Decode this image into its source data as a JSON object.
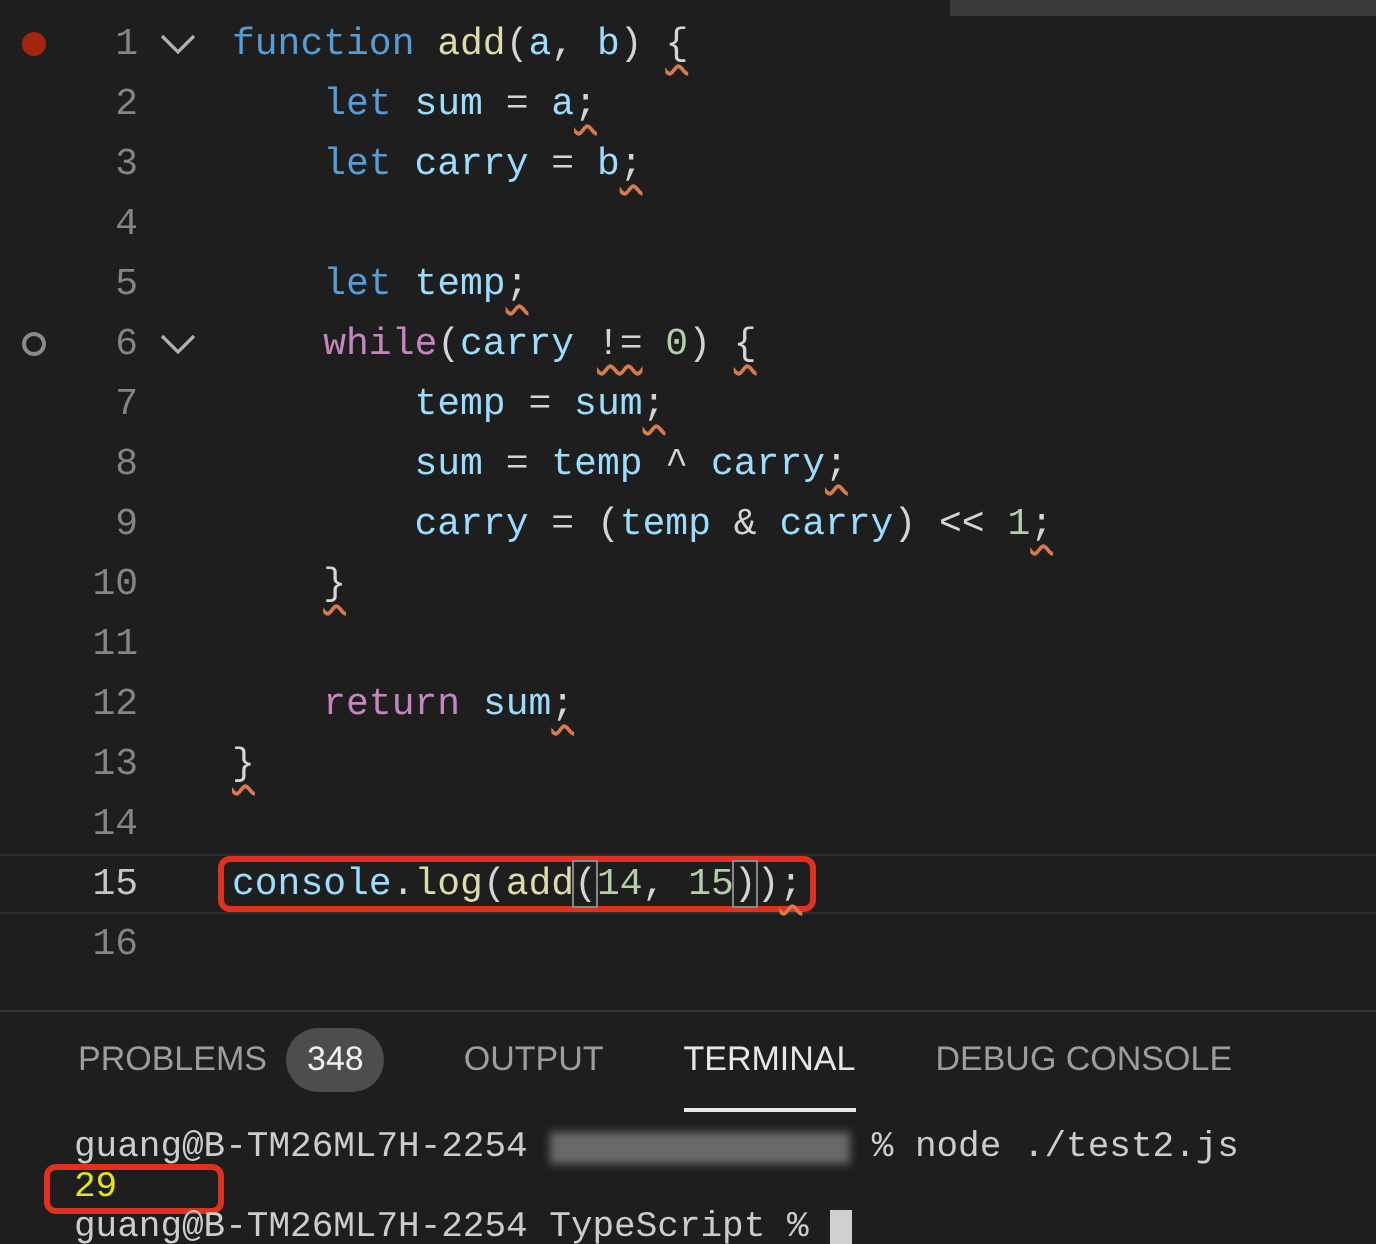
{
  "editor": {
    "lines": [
      {
        "number": "1",
        "breakpoint": true,
        "hint": false,
        "foldable": true,
        "current": false,
        "highlighted": false,
        "tokens": [
          {
            "text": "function ",
            "kind": "kw",
            "warning": false
          },
          {
            "text": "add",
            "kind": "fn",
            "warning": false
          },
          {
            "text": "(",
            "kind": "p",
            "warning": false
          },
          {
            "text": "a",
            "kind": "var",
            "warning": false
          },
          {
            "text": ", ",
            "kind": "p",
            "warning": false
          },
          {
            "text": "b",
            "kind": "var",
            "warning": false
          },
          {
            "text": ") ",
            "kind": "p",
            "warning": false
          },
          {
            "text": "{",
            "kind": "p",
            "warning": true
          }
        ]
      },
      {
        "number": "2",
        "breakpoint": false,
        "hint": false,
        "foldable": false,
        "current": false,
        "highlighted": false,
        "tokens": [
          {
            "text": "    let ",
            "kind": "kw",
            "warning": false
          },
          {
            "text": "sum",
            "kind": "var",
            "warning": false
          },
          {
            "text": " = ",
            "kind": "p",
            "warning": false
          },
          {
            "text": "a",
            "kind": "var",
            "warning": false
          },
          {
            "text": ";",
            "kind": "p",
            "warning": true
          }
        ]
      },
      {
        "number": "3",
        "breakpoint": false,
        "hint": false,
        "foldable": false,
        "current": false,
        "highlighted": false,
        "tokens": [
          {
            "text": "    let ",
            "kind": "kw",
            "warning": false
          },
          {
            "text": "carry",
            "kind": "var",
            "warning": false
          },
          {
            "text": " = ",
            "kind": "p",
            "warning": false
          },
          {
            "text": "b",
            "kind": "var",
            "warning": false
          },
          {
            "text": ";",
            "kind": "p",
            "warning": true
          }
        ]
      },
      {
        "number": "4",
        "breakpoint": false,
        "hint": false,
        "foldable": false,
        "current": false,
        "highlighted": false
      },
      {
        "number": "5",
        "breakpoint": false,
        "hint": false,
        "foldable": false,
        "current": false,
        "highlighted": false,
        "tokens": [
          {
            "text": "    let ",
            "kind": "kw",
            "warning": false
          },
          {
            "text": "temp",
            "kind": "var",
            "warning": false
          },
          {
            "text": ";",
            "kind": "p",
            "warning": true
          }
        ]
      },
      {
        "number": "6",
        "breakpoint": false,
        "hint": true,
        "foldable": true,
        "current": false,
        "highlighted": false,
        "tokens": [
          {
            "text": "    while",
            "kind": "ctl",
            "warning": false
          },
          {
            "text": "(",
            "kind": "p",
            "warning": false
          },
          {
            "text": "carry ",
            "kind": "var",
            "warning": false
          },
          {
            "text": "!=",
            "kind": "p",
            "warning": true
          },
          {
            "text": " 0",
            "kind": "num",
            "warning": false
          },
          {
            "text": ") ",
            "kind": "p",
            "warning": false
          },
          {
            "text": "{",
            "kind": "p",
            "warning": true
          }
        ]
      },
      {
        "number": "7",
        "breakpoint": false,
        "hint": false,
        "foldable": false,
        "current": false,
        "highlighted": false,
        "tokens": [
          {
            "text": "        temp",
            "kind": "var",
            "warning": false
          },
          {
            "text": " = ",
            "kind": "p",
            "warning": false
          },
          {
            "text": "sum",
            "kind": "var",
            "warning": false
          },
          {
            "text": ";",
            "kind": "p",
            "warning": true
          }
        ]
      },
      {
        "number": "8",
        "breakpoint": false,
        "hint": false,
        "foldable": false,
        "current": false,
        "highlighted": false,
        "tokens": [
          {
            "text": "        sum",
            "kind": "var",
            "warning": false
          },
          {
            "text": " = ",
            "kind": "p",
            "warning": false
          },
          {
            "text": "temp",
            "kind": "var",
            "warning": false
          },
          {
            "text": " ^ ",
            "kind": "p",
            "warning": false
          },
          {
            "text": "carry",
            "kind": "var",
            "warning": false
          },
          {
            "text": ";",
            "kind": "p",
            "warning": true
          }
        ]
      },
      {
        "number": "9",
        "breakpoint": false,
        "hint": false,
        "foldable": false,
        "current": false,
        "highlighted": false,
        "tokens": [
          {
            "text": "        carry",
            "kind": "var",
            "warning": false
          },
          {
            "text": " = (",
            "kind": "p",
            "warning": false
          },
          {
            "text": "temp",
            "kind": "var",
            "warning": false
          },
          {
            "text": " & ",
            "kind": "p",
            "warning": false
          },
          {
            "text": "carry",
            "kind": "var",
            "warning": false
          },
          {
            "text": ") << ",
            "kind": "p",
            "warning": false
          },
          {
            "text": "1",
            "kind": "num",
            "warning": false
          },
          {
            "text": ";",
            "kind": "p",
            "warning": true
          }
        ]
      },
      {
        "number": "10",
        "breakpoint": false,
        "hint": false,
        "foldable": false,
        "current": false,
        "highlighted": false,
        "tokens": [
          {
            "text": "    }",
            "kind": "p",
            "warning": true
          }
        ]
      },
      {
        "number": "11",
        "breakpoint": false,
        "hint": false,
        "foldable": false,
        "current": false,
        "highlighted": false
      },
      {
        "number": "12",
        "breakpoint": false,
        "hint": false,
        "foldable": false,
        "current": false,
        "highlighted": false,
        "tokens": [
          {
            "text": "    return ",
            "kind": "ctl",
            "warning": false
          },
          {
            "text": "sum",
            "kind": "var",
            "warning": false
          },
          {
            "text": ";",
            "kind": "p",
            "warning": true
          }
        ]
      },
      {
        "number": "13",
        "breakpoint": false,
        "hint": false,
        "foldable": false,
        "current": false,
        "highlighted": false,
        "tokens": [
          {
            "text": "}",
            "kind": "p",
            "warning": true
          }
        ]
      },
      {
        "number": "14",
        "breakpoint": false,
        "hint": false,
        "foldable": false,
        "current": false,
        "highlighted": false
      },
      {
        "number": "15",
        "breakpoint": false,
        "hint": false,
        "foldable": false,
        "current": true,
        "highlighted": true,
        "tokens": [
          {
            "text": "console",
            "kind": "var",
            "warning": false
          },
          {
            "text": ".",
            "kind": "p",
            "warning": false
          },
          {
            "text": "log",
            "kind": "fn",
            "warning": false
          },
          {
            "text": "(",
            "kind": "p",
            "warning": false
          },
          {
            "text": "add",
            "kind": "fn",
            "warning": false
          },
          {
            "text": "(",
            "kind": "match",
            "warning": false
          },
          {
            "text": "14",
            "kind": "num",
            "warning": false
          },
          {
            "text": ", ",
            "kind": "p",
            "warning": false
          },
          {
            "text": "15",
            "kind": "num",
            "warning": false
          },
          {
            "text": ")",
            "kind": "match",
            "warning": false
          },
          {
            "text": ")",
            "kind": "p",
            "warning": false
          },
          {
            "text": ";",
            "kind": "p",
            "warning": true
          }
        ]
      },
      {
        "number": "16",
        "breakpoint": false,
        "hint": false,
        "foldable": false,
        "current": false,
        "highlighted": false
      }
    ]
  },
  "panel": {
    "tabs": [
      {
        "label": "PROBLEMS",
        "badge": "348",
        "selected": false
      },
      {
        "label": "OUTPUT",
        "selected": false
      },
      {
        "label": "TERMINAL",
        "selected": true
      },
      {
        "label": "DEBUG CONSOLE",
        "selected": false
      }
    ],
    "terminal": {
      "lines": [
        {
          "highlighted": false,
          "cursor": false,
          "segments": [
            {
              "kind": "text",
              "text": "guang@B-TM26ML7H-2254"
            },
            {
              "kind": "redacted"
            },
            {
              "kind": "text",
              "text": "% node ./test2.js"
            }
          ]
        },
        {
          "highlighted": true,
          "cursor": false,
          "segments": [
            {
              "kind": "output",
              "text": "29"
            }
          ]
        },
        {
          "highlighted": false,
          "cursor": true,
          "segments": [
            {
              "kind": "text",
              "text": "guang@B-TM26ML7H-2254 TypeScript %"
            }
          ]
        }
      ]
    }
  }
}
